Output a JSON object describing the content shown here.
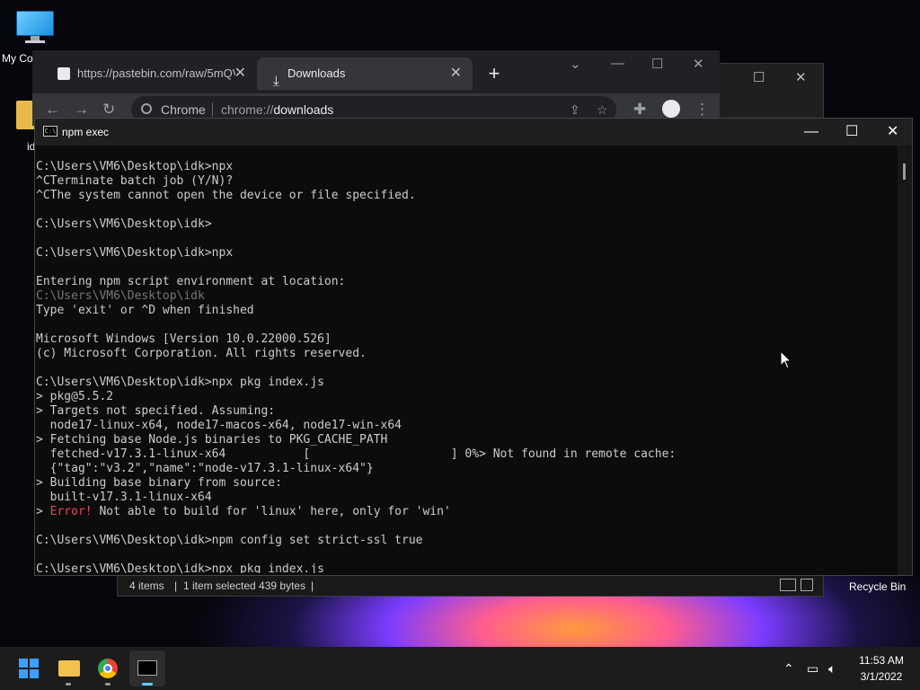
{
  "desktop": {
    "icons": [
      {
        "label": "My Co"
      },
      {
        "label": "id"
      }
    ],
    "recycle_bin_label": "Recycle Bin"
  },
  "explorer": {
    "items_count": "4 items",
    "selection": "1 item selected  439 bytes",
    "separator": "|"
  },
  "chrome": {
    "tabs": [
      {
        "title": "https://pastebin.com/raw/5mQV",
        "active": false
      },
      {
        "title": "Downloads",
        "active": true
      }
    ],
    "omnibox": {
      "chip": "Chrome",
      "scheme": "chrome://",
      "path": "downloads"
    }
  },
  "terminal": {
    "title": "npm exec",
    "lines": [
      "C:\\Users\\VM6\\Desktop\\idk>npx",
      "^CTerminate batch job (Y/N)?",
      "^CThe system cannot open the device or file specified.",
      "",
      "C:\\Users\\VM6\\Desktop\\idk>",
      "",
      "C:\\Users\\VM6\\Desktop\\idk>npx",
      "",
      "Entering npm script environment at location:",
      "C:\\Users\\VM6\\Desktop\\idk",
      "Type 'exit' or ^D when finished",
      "",
      "Microsoft Windows [Version 10.0.22000.526]",
      "(c) Microsoft Corporation. All rights reserved.",
      "",
      "C:\\Users\\VM6\\Desktop\\idk>npx pkg index.js",
      "> pkg@5.5.2",
      "> Targets not specified. Assuming:",
      "  node17-linux-x64, node17-macos-x64, node17-win-x64",
      "> Fetching base Node.js binaries to PKG_CACHE_PATH",
      "  fetched-v17.3.1-linux-x64           [                    ] 0%> Not found in remote cache:",
      "  {\"tag\":\"v3.2\",\"name\":\"node-v17.3.1-linux-x64\"}",
      "> Building base binary from source:",
      "  built-v17.3.1-linux-x64",
      "> ",
      "",
      "C:\\Users\\VM6\\Desktop\\idk>npm config set strict-ssl true",
      "",
      "C:\\Users\\VM6\\Desktop\\idk>npx pkg index.js"
    ],
    "dim_line_index": 9,
    "error_line": {
      "index": 24,
      "prefix": "> ",
      "error_word": "Error!",
      "message": " Not able to build for 'linux' here, only for 'win'"
    }
  },
  "taskbar": {
    "apps": [
      {
        "name": "Start"
      },
      {
        "name": "File Explorer"
      },
      {
        "name": "Google Chrome"
      },
      {
        "name": "Command Prompt",
        "active": true
      }
    ],
    "time": "11:53 AM",
    "date": "3/1/2022"
  },
  "colors": {
    "terminal_bg": "#0c0c0c",
    "terminal_fg": "#cccccc",
    "error": "#e74856",
    "accent": "#60cdff"
  }
}
